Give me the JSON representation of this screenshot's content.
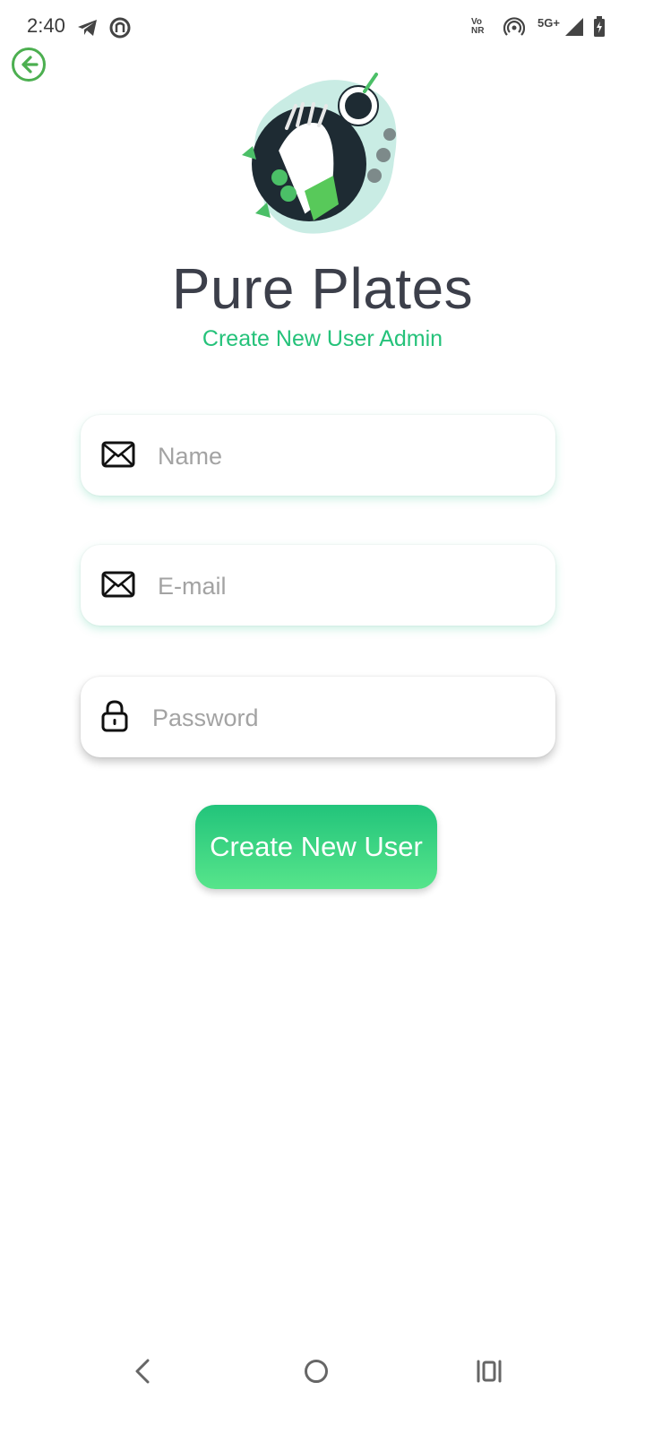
{
  "status_bar": {
    "time": "2:40",
    "network": "5G+",
    "volte": "Vo NR"
  },
  "header": {
    "back_icon": "arrow-left-circle-icon",
    "accent_color": "#4caf50"
  },
  "app": {
    "title": "Pure Plates",
    "subtitle": "Create New User Admin"
  },
  "form": {
    "name_placeholder": "Name",
    "email_placeholder": "E-mail",
    "password_placeholder": "Password",
    "name_icon": "envelope-icon",
    "email_icon": "envelope-icon",
    "password_icon": "lock-icon",
    "submit_label": "Create New User"
  },
  "colors": {
    "subtitle": "#25c27a",
    "button_top": "#22c47b",
    "button_bottom": "#57e58b",
    "title": "#3c3f4a"
  },
  "nav": {
    "back_icon": "chevron-left-icon",
    "home_icon": "circle-home-icon",
    "recents_icon": "recents-icon"
  }
}
